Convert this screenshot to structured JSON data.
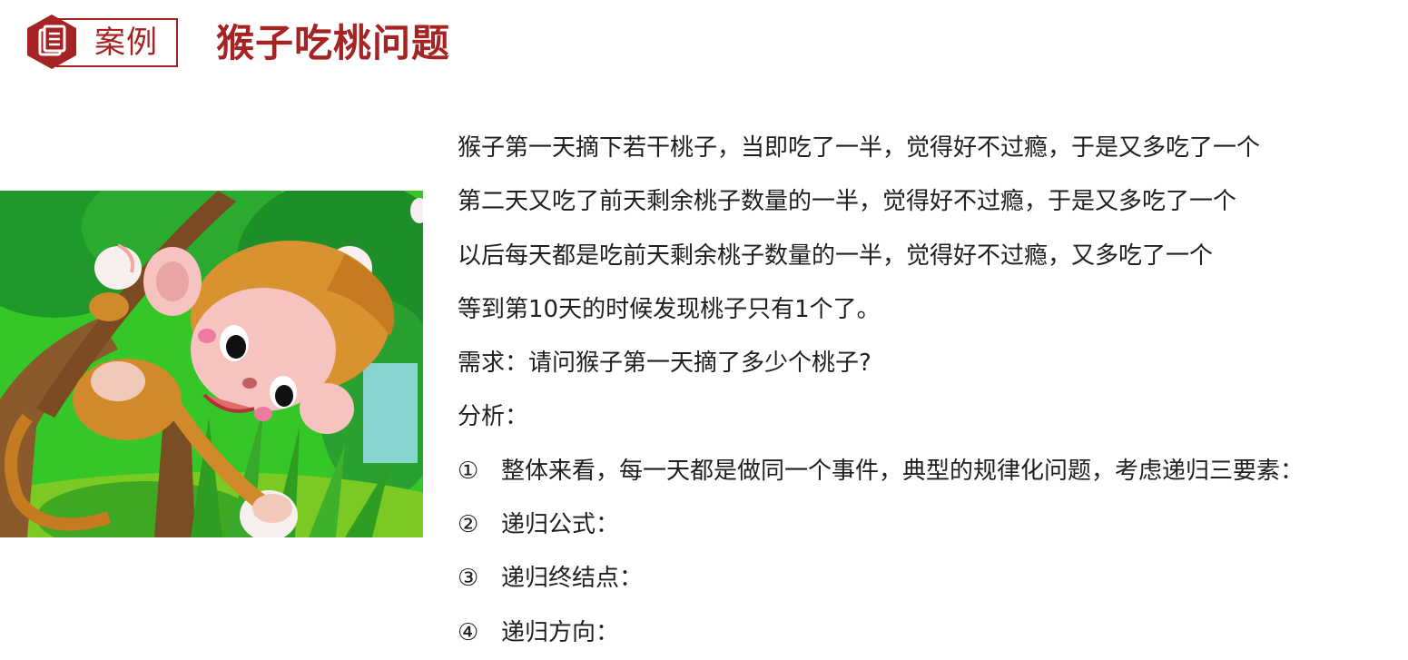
{
  "header": {
    "badge_label": "案例",
    "title": "猴子吃桃问题",
    "icon": "document-icon",
    "accent_color": "#a52323"
  },
  "illustration": {
    "subject": "cartoon-monkey-with-peaches"
  },
  "content": {
    "paragraphs": [
      "猴子第一天摘下若干桃子，当即吃了一半，觉得好不过瘾，于是又多吃了一个",
      "第二天又吃了前天剩余桃子数量的一半，觉得好不过瘾，于是又多吃了一个",
      "以后每天都是吃前天剩余桃子数量的一半，觉得好不过瘾，又多吃了一个",
      "等到第10天的时候发现桃子只有1个了。",
      "需求：请问猴子第一天摘了多少个桃子?",
      "分析："
    ],
    "steps": [
      {
        "num": "①",
        "text": "整体来看，每一天都是做同一个事件，典型的规律化问题，考虑递归三要素："
      },
      {
        "num": "②",
        "text": "递归公式："
      },
      {
        "num": "③",
        "text": "递归终结点："
      },
      {
        "num": "④",
        "text": "递归方向："
      }
    ]
  }
}
